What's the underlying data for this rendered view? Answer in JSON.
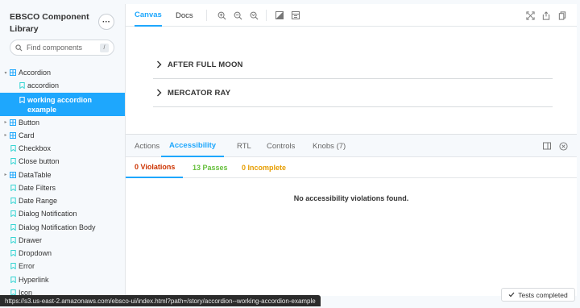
{
  "sidebar": {
    "title": "EBSCO Component Library",
    "menu_label": "···",
    "search_placeholder": "Find components",
    "search_shortcut": "/",
    "tree": [
      {
        "label": "Accordion",
        "level": 0,
        "type": "component",
        "expanded": true
      },
      {
        "label": "accordion",
        "level": 1,
        "type": "story"
      },
      {
        "label": "working accordion example",
        "level": 1,
        "type": "story",
        "selected": true
      },
      {
        "label": "Button",
        "level": 0,
        "type": "component"
      },
      {
        "label": "Card",
        "level": 0,
        "type": "component"
      },
      {
        "label": "Checkbox",
        "level": 0,
        "type": "story"
      },
      {
        "label": "Close button",
        "level": 0,
        "type": "story"
      },
      {
        "label": "DataTable",
        "level": 0,
        "type": "component"
      },
      {
        "label": "Date Filters",
        "level": 0,
        "type": "story"
      },
      {
        "label": "Date Range",
        "level": 0,
        "type": "story"
      },
      {
        "label": "Dialog Notification",
        "level": 0,
        "type": "story"
      },
      {
        "label": "Dialog Notification Body",
        "level": 0,
        "type": "story"
      },
      {
        "label": "Drawer",
        "level": 0,
        "type": "story"
      },
      {
        "label": "Dropdown",
        "level": 0,
        "type": "story"
      },
      {
        "label": "Error",
        "level": 0,
        "type": "story"
      },
      {
        "label": "Hyperlink",
        "level": 0,
        "type": "story"
      },
      {
        "label": "Icon",
        "level": 0,
        "type": "story"
      }
    ]
  },
  "toolbar": {
    "tabs": [
      "Canvas",
      "Docs"
    ],
    "active_tab": "Canvas",
    "tools": [
      "zoom-in-icon",
      "zoom-out-icon",
      "zoom-reset-icon",
      "background-icon",
      "grid-icon"
    ],
    "right_tools": [
      "fullscreen-icon",
      "share-icon",
      "copy-link-icon"
    ]
  },
  "canvas": {
    "accordion_items": [
      "AFTER FULL MOON",
      "MERCATOR RAY"
    ]
  },
  "addons": {
    "tabs": [
      "Actions",
      "Accessibility",
      "RTL",
      "Controls",
      "Knobs (7)"
    ],
    "active_tab": "Accessibility",
    "subtabs": [
      {
        "label": "0 Violations",
        "color": "#cc3300"
      },
      {
        "label": "13 Passes",
        "color": "#66bf3c"
      },
      {
        "label": "0 Incomplete",
        "color": "#e69d00"
      }
    ],
    "message": "No accessibility violations found."
  },
  "statusbar": {
    "url": "https://s3.us-east-2.amazonaws.com/ebsco-ui/index.html?path=/story/accordion--working-accordion-example"
  },
  "tests_badge": {
    "label": "Tests completed"
  },
  "colors": {
    "accent": "#1ea7fd",
    "sidebar_bg": "#f6f9fc"
  }
}
